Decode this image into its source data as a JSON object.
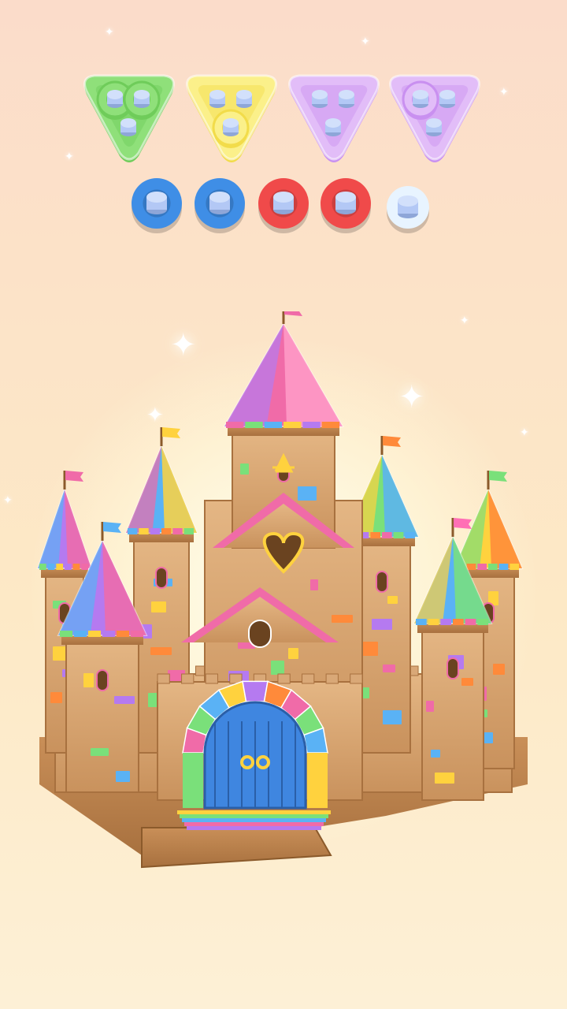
{
  "game": {
    "trays": [
      {
        "shape": "triangle",
        "fill": "#8fe07a",
        "rim": "#6fcc5a",
        "pegs": [
          "ring",
          "ring",
          "peg"
        ]
      },
      {
        "shape": "triangle",
        "fill": "#fbf08a",
        "rim": "#f2dc4a",
        "pegs": [
          "peg",
          "peg",
          "ring"
        ]
      },
      {
        "shape": "triangle",
        "fill": "#e2bdf8",
        "rim": "#c990f0",
        "pegs": [
          "peg",
          "peg",
          "peg"
        ]
      },
      {
        "shape": "triangle",
        "fill": "#e2bdf8",
        "rim": "#c990f0",
        "pegs": [
          "ring",
          "peg",
          "peg"
        ]
      }
    ],
    "slots": [
      {
        "color": "#3f8ee6",
        "state": "filled"
      },
      {
        "color": "#3f8ee6",
        "state": "filled"
      },
      {
        "color": "#f04a4a",
        "state": "filled"
      },
      {
        "color": "#f04a4a",
        "state": "filled"
      },
      {
        "color": "#e8f4ff",
        "state": "empty"
      }
    ],
    "peg_color": "#b3c8f5",
    "castle": {
      "wall_color": "#d9a877",
      "door_color": "#3f86e0",
      "flag_colors": [
        "#f06ba8",
        "#ffd23e",
        "#5ab2f5",
        "#ff8a3a",
        "#7ae07a",
        "#ff6fb5"
      ],
      "patch_colors": [
        "#f06ba8",
        "#7ae07a",
        "#5ab2f5",
        "#ffd23e",
        "#b57af0",
        "#ff8a3a"
      ]
    }
  }
}
